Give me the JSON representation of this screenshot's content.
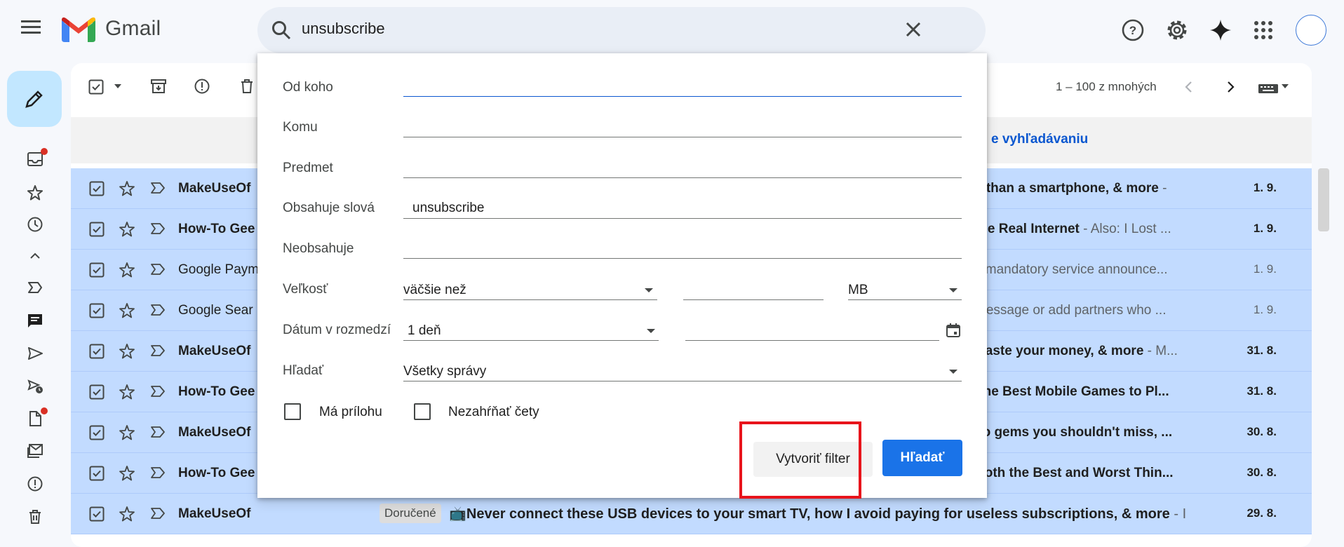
{
  "app": {
    "name": "Gmail"
  },
  "search": {
    "value": "unsubscribe"
  },
  "toolbar": {
    "pagination": "1 – 100 z mnohých"
  },
  "banner": {
    "text": "e vyhľadávaniu"
  },
  "emails": [
    {
      "sender": "MakeUseOf",
      "subject": "e than a smartphone, & more",
      "snippet": " -",
      "date": "1. 9.",
      "unread": true
    },
    {
      "sender": "How-To Gee",
      "subject": "the Real Internet",
      "snippet": " - Also: I Lost ...",
      "date": "1. 9.",
      "unread": true
    },
    {
      "sender": "Google Paym",
      "subject": "",
      "snippet": "s mandatory service announce...",
      "date": "1. 9.",
      "unread": false
    },
    {
      "sender": "Google Sear",
      "subject": "",
      "snippet": " message or add partners who ...",
      "date": "1. 9.",
      "unread": false
    },
    {
      "sender": "MakeUseOf",
      "subject": "waste your money, & more",
      "snippet": " - M...",
      "date": "31. 8.",
      "unread": true
    },
    {
      "sender": "How-To Gee",
      "subject": "The Best Mobile Games to Pl...",
      "snippet": "",
      "date": "31. 8.",
      "unread": true
    },
    {
      "sender": "MakeUseOf",
      "subject": "eo gems you shouldn't miss, ...",
      "snippet": "",
      "date": "30. 8.",
      "unread": true
    },
    {
      "sender": "How-To Gee",
      "subject": "Both the Best and Worst Thin...",
      "snippet": "",
      "date": "30. 8.",
      "unread": true
    },
    {
      "sender": "MakeUseOf",
      "subject": "",
      "snippet": "",
      "date": "29. 8.",
      "unread": true
    }
  ],
  "last_email": {
    "label": "Doručené",
    "subject": "📺Never connect these USB devices to your smart TV, how I avoid paying for useless subscriptions, & more",
    "snippet": " - I"
  },
  "search_panel": {
    "from_label": "Od koho",
    "to_label": "Komu",
    "subject_label": "Predmet",
    "has_words_label": "Obsahuje slová",
    "has_words_value": "unsubscribe",
    "doesnt_have_label": "Neobsahuje",
    "size_label": "Veľkosť",
    "size_operator": "väčšie než",
    "size_unit": "MB",
    "date_label": "Dátum v rozmedzí",
    "date_value": "1 deň",
    "search_in_label": "Hľadať",
    "search_in_value": "Všetky správy",
    "has_attachment_label": "Má prílohu",
    "exclude_chats_label": "Nezahŕňať čety",
    "create_filter_label": "Vytvoriť filter",
    "search_button_label": "Hľadať"
  },
  "colors": {
    "accent": "#1a73e8",
    "selected_row": "#c2dbff",
    "highlight": "#e8141b"
  }
}
